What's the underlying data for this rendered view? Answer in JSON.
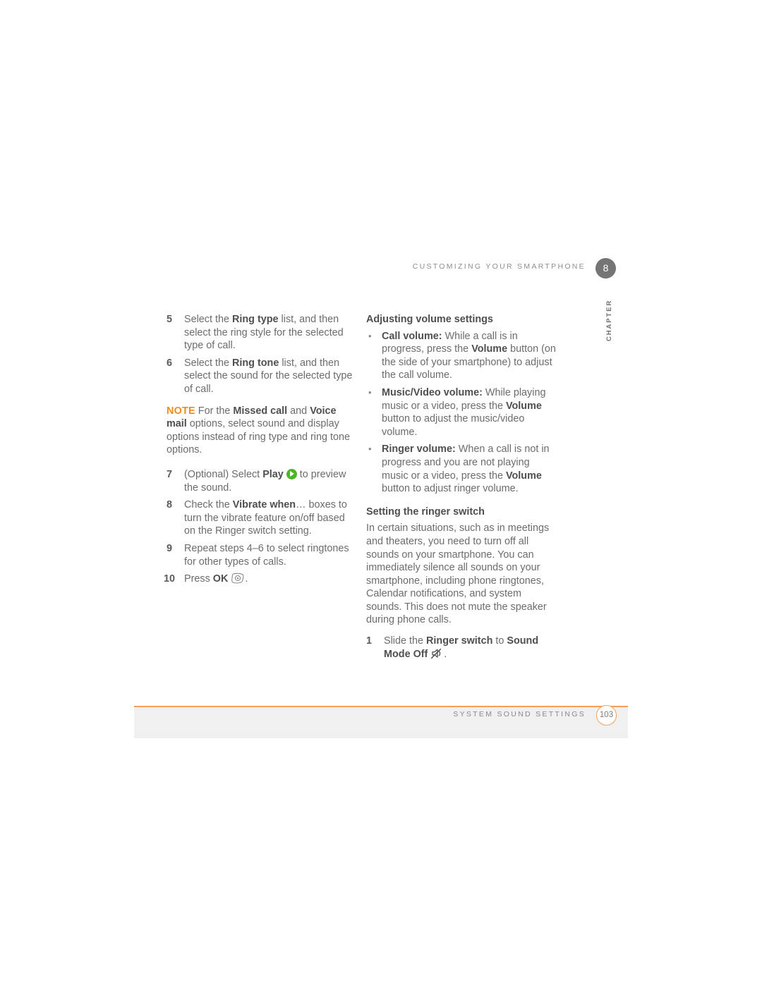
{
  "header": {
    "running_title": "CUSTOMIZING YOUR SMARTPHONE",
    "chapter_number": "8",
    "chapter_label": "CHAPTER"
  },
  "left_column": {
    "steps": [
      {
        "number": "5",
        "parts": [
          {
            "text": "Select the ",
            "bold": false
          },
          {
            "text": "Ring type",
            "bold": true
          },
          {
            "text": " list, and then select the ring style for the selected type of call.",
            "bold": false
          }
        ]
      },
      {
        "number": "6",
        "parts": [
          {
            "text": "Select the ",
            "bold": false
          },
          {
            "text": "Ring tone",
            "bold": true
          },
          {
            "text": " list, and then select the sound for the selected type of call.",
            "bold": false
          }
        ]
      }
    ],
    "note": {
      "label": "NOTE",
      "parts": [
        {
          "text": " For the ",
          "bold": false
        },
        {
          "text": "Missed call",
          "bold": true
        },
        {
          "text": " and ",
          "bold": false
        },
        {
          "text": "Voice mail",
          "bold": true
        },
        {
          "text": " options, select sound and display options instead of ring type and ring tone options.",
          "bold": false
        }
      ]
    },
    "steps2": [
      {
        "number": "7",
        "parts": [
          {
            "text": "(Optional) Select ",
            "bold": false
          },
          {
            "text": "Play",
            "bold": true
          },
          {
            "text": " ",
            "bold": false
          },
          {
            "icon": "play-icon"
          },
          {
            "text": " to preview the sound.",
            "bold": false
          }
        ]
      },
      {
        "number": "8",
        "parts": [
          {
            "text": "Check the ",
            "bold": false
          },
          {
            "text": "Vibrate when",
            "bold": true
          },
          {
            "text": "… boxes to turn the vibrate feature on/off based on the Ringer switch setting.",
            "bold": false
          }
        ]
      },
      {
        "number": "9",
        "parts": [
          {
            "text": "Repeat steps 4–6 to select ringtones for other types of calls.",
            "bold": false
          }
        ]
      },
      {
        "number": "10",
        "parts": [
          {
            "text": "Press ",
            "bold": false
          },
          {
            "text": "OK",
            "bold": true
          },
          {
            "text": " ",
            "bold": false
          },
          {
            "icon": "ok-key-icon"
          },
          {
            "text": ".",
            "bold": false
          }
        ]
      }
    ]
  },
  "right_column": {
    "heading1": "Adjusting volume settings",
    "bullets": [
      {
        "parts": [
          {
            "text": "Call volume:",
            "bold": true
          },
          {
            "text": " While a call is in progress, press the ",
            "bold": false
          },
          {
            "text": "Volume",
            "bold": true
          },
          {
            "text": " button (on the side of your smartphone) to adjust the call volume.",
            "bold": false
          }
        ]
      },
      {
        "parts": [
          {
            "text": "Music/Video volume:",
            "bold": true
          },
          {
            "text": " While playing music or a video, press the ",
            "bold": false
          },
          {
            "text": "Volume",
            "bold": true
          },
          {
            "text": " button to adjust the music/video volume.",
            "bold": false
          }
        ]
      },
      {
        "parts": [
          {
            "text": "Ringer volume:",
            "bold": true
          },
          {
            "text": " When a call is not in progress and you are not playing music or a video, press the ",
            "bold": false
          },
          {
            "text": "Volume",
            "bold": true
          },
          {
            "text": " button to adjust ringer volume.",
            "bold": false
          }
        ]
      }
    ],
    "heading2": "Setting the ringer switch",
    "paragraph": "In certain situations, such as in meetings and theaters, you need to turn off all sounds on your smartphone. You can immediately silence all sounds on your smartphone, including phone ringtones, Calendar notifications, and system sounds. This does not mute the speaker during phone calls.",
    "steps": [
      {
        "number": "1",
        "parts": [
          {
            "text": "Slide the ",
            "bold": false
          },
          {
            "text": "Ringer switch",
            "bold": true
          },
          {
            "text": " to ",
            "bold": false
          },
          {
            "text": "Sound Mode Off",
            "bold": true
          },
          {
            "text": " ",
            "bold": false
          },
          {
            "icon": "sound-off-icon"
          },
          {
            "text": ".",
            "bold": false
          }
        ]
      }
    ]
  },
  "footer": {
    "section_title": "SYSTEM SOUND SETTINGS",
    "page_number": "103"
  },
  "colors": {
    "accent_orange": "#f08b1d",
    "rule_orange": "#f5a05a",
    "body_gray": "#6c6c6c",
    "bold_gray": "#4f4f4f",
    "band_gray": "#f0f0f0",
    "chapter_badge": "#757575",
    "play_green": "#4fb526"
  }
}
